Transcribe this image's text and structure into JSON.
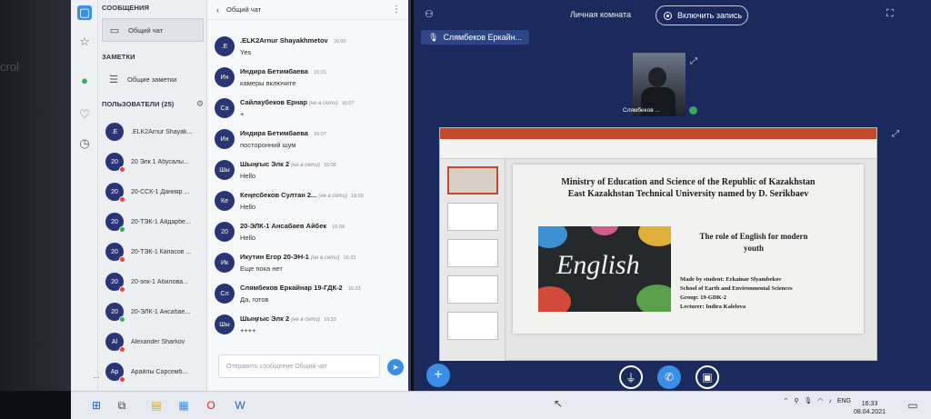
{
  "bezel": {
    "text": "crol"
  },
  "sidebar": {
    "messages_header": "СООБЩЕНИЯ",
    "general_chat_label": "Общий чат",
    "notes_header": "ЗАМЕТКИ",
    "general_notes_label": "Общие заметки",
    "users_header": "ПОЛЬЗОВАТЕЛИ (25)",
    "users": [
      {
        "initials": ".E",
        "name": ".ELK2Arnur Shayak...",
        "status": "none"
      },
      {
        "initials": "20",
        "name": "20 Элк 1 Абусалы...",
        "status": "red"
      },
      {
        "initials": "20",
        "name": "20-ССК-1 Данияр ...",
        "status": "red"
      },
      {
        "initials": "20",
        "name": "20-ТЭК-1 Айдарбе...",
        "status": "green"
      },
      {
        "initials": "20",
        "name": "20-ТЭК-1 Капасов ...",
        "status": "red"
      },
      {
        "initials": "20",
        "name": "20-элк-1 Абилова...",
        "status": "red"
      },
      {
        "initials": "20",
        "name": "20-ЭЛК-1 Ансабае...",
        "status": "green"
      },
      {
        "initials": "Al",
        "name": "Alexander Sharkov",
        "status": "red"
      },
      {
        "initials": "Ар",
        "name": "Арайлы Сарсемб...",
        "status": "red"
      }
    ],
    "more": "..."
  },
  "chat": {
    "title": "Общий чат",
    "messages": [
      {
        "initials": ".E",
        "author": ".ELK2Arnur Shayakhmetov",
        "status": "",
        "time": "16:00",
        "text": "Yes"
      },
      {
        "initials": "Ин",
        "author": "Индира Бетимбаева",
        "status": "",
        "time": "16:01",
        "text": "камеры включите"
      },
      {
        "initials": "Са",
        "author": "Сайлаубеков Ернар",
        "status": "(не в сети)",
        "time": "16:07",
        "text": "+"
      },
      {
        "initials": "Ин",
        "author": "Индира Бетимбаева",
        "status": "",
        "time": "16:07",
        "text": "посторонний шум"
      },
      {
        "initials": "Шы",
        "author": "Шыңғыс Элк 2",
        "status": "(не в сети)",
        "time": "16:08",
        "text": "Hello"
      },
      {
        "initials": "Ке",
        "author": "Кеңесбеков Султан 2...",
        "status": "(не в сети)",
        "time": "16:09",
        "text": "Hello"
      },
      {
        "initials": "20",
        "author": "20-ЭЛК-1 Ансабаев Айбек",
        "status": "",
        "time": "16:09",
        "text": "Hello"
      },
      {
        "initials": "Ик",
        "author": "Икутин Егор 20-ЭН-1",
        "status": "(не в сети)",
        "time": "16:33",
        "text": "Еще пока нет"
      },
      {
        "initials": "Сл",
        "author": "Слямбеков Еркайнар 19-ГДК-2",
        "status": "",
        "time": "16:33",
        "text": "Да, готов"
      },
      {
        "initials": "Шы",
        "author": "Шыңғыс Элк 2",
        "status": "(не в сети)",
        "time": "16:33",
        "text": "++++"
      }
    ],
    "input_placeholder": "Отправить сообщение Общий чат"
  },
  "call": {
    "room_name": "Личная комната",
    "record_label": "Включить запись",
    "speaker": "Слямбеков Еркайн...",
    "video_label": "Слямбеков ...",
    "slide": {
      "title_line1": "Ministry of Education and Science of the Republic of Kazakhstan",
      "title_line2": "East Kazakhstan Technical University named by D. Serikbaev",
      "image_word": "English",
      "topic_line1": "The role of English for modern",
      "topic_line2": "youth",
      "made_by": "Made by student: Erkainar Slyambekov",
      "school": "School of Earth and Environmental Sciences",
      "group": "Group: 19-GDK-2",
      "lecturer": "Lecturer: Indira Kalelova"
    }
  },
  "taskbar": {
    "lang": "ENG",
    "time": "16:33",
    "date": "08.04.2021"
  },
  "colors": {
    "navy": "#1b2a5c",
    "accent": "#3b8ee8",
    "avatar": "#2a3575",
    "offline": "#d94a3a",
    "online": "#3aa85a"
  }
}
